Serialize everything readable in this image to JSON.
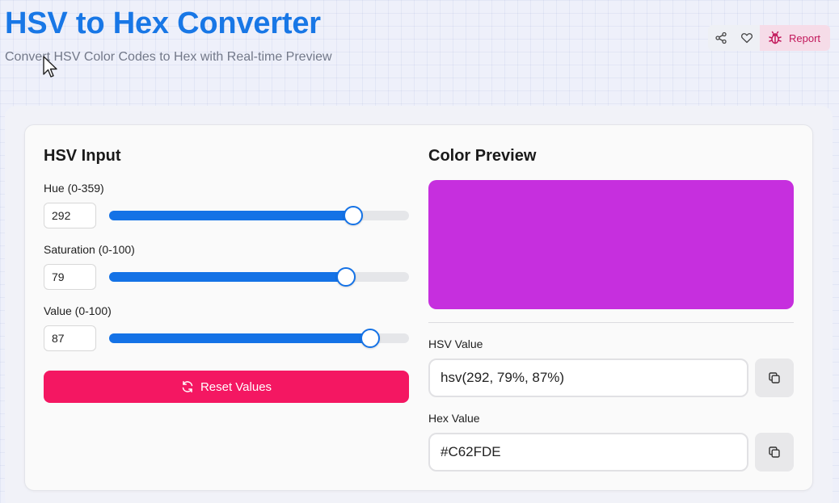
{
  "header": {
    "title": "HSV to Hex Converter",
    "subtitle": "Convert HSV Color Codes to Hex with Real-time Preview",
    "actions": {
      "share_icon": "share-icon",
      "favorite_icon": "heart-icon",
      "report_icon": "bug-icon",
      "report_label": "Report"
    }
  },
  "input_panel": {
    "title": "HSV Input",
    "fields": [
      {
        "label": "Hue (0-359)",
        "value": "292",
        "min": 0,
        "max": 359,
        "level": 292
      },
      {
        "label": "Saturation (0-100)",
        "value": "79",
        "min": 0,
        "max": 100,
        "level": 79
      },
      {
        "label": "Value (0-100)",
        "value": "87",
        "min": 0,
        "max": 100,
        "level": 87
      }
    ],
    "reset_label": "Reset Values",
    "reset_icon": "refresh-icon"
  },
  "preview_panel": {
    "title": "Color Preview",
    "color": "#C62FDE",
    "hsv_label": "HSV Value",
    "hsv_value": "hsv(292, 79%, 87%)",
    "hex_label": "Hex Value",
    "hex_value": "#C62FDE",
    "copy_icon": "copy-icon"
  },
  "colors": {
    "title_blue": "#1877e6",
    "slider_blue": "#1472e6",
    "reset_pink": "#f41762",
    "report_pink": "#c2185b"
  }
}
